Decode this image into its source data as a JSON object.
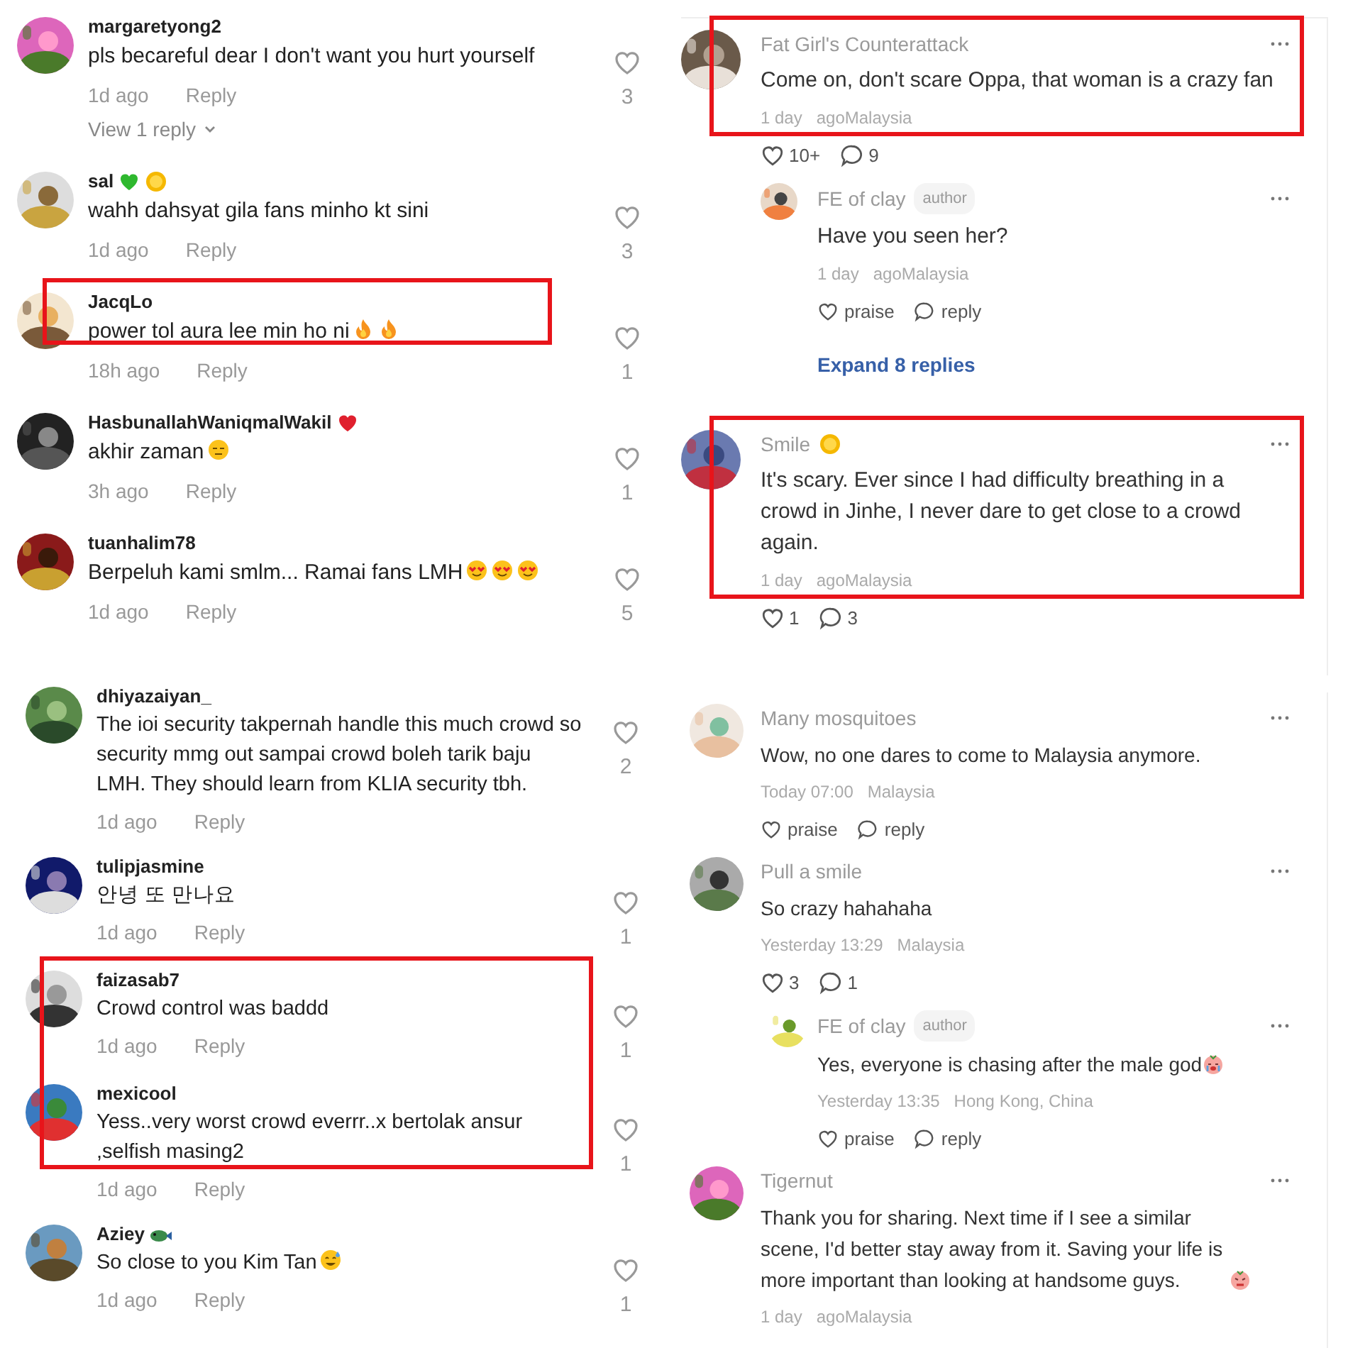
{
  "panels": [
    {
      "kind": "plain",
      "comments": [
        {
          "user": "margaretyong2",
          "text": "pls becareful dear I don't want you hurt yourself",
          "time": "1d ago",
          "reply": "Reply",
          "likes": "3",
          "view_replies": "View 1 reply",
          "highlighted": false
        },
        {
          "user": "sal",
          "text": "wahh dahsyat gila fans minho kt sini",
          "time": "1d ago",
          "reply": "Reply",
          "likes": "3",
          "highlighted": false
        },
        {
          "user": "JacqLo",
          "text": "power tol aura lee min ho ni",
          "time": "18h ago",
          "reply": "Reply",
          "likes": "1",
          "highlighted": true
        },
        {
          "user": "HasbunallahWaniqmalWakil",
          "text": "akhir zaman",
          "time": "3h ago",
          "reply": "Reply",
          "likes": "1",
          "highlighted": false
        },
        {
          "user": "tuanhalim78",
          "text": "Berpeluh kami smlm... Ramai fans LMH",
          "time": "1d ago",
          "reply": "Reply",
          "likes": "5",
          "highlighted": false
        }
      ]
    },
    {
      "kind": "threaded",
      "comments": [
        {
          "user": "Fat Girl's Counterattack",
          "text": "Come on, don't scare Oppa, that woman is a crazy fan",
          "time": "1 day",
          "location": "agoMalaysia",
          "actions": {
            "kind": "counts",
            "likes": "10+",
            "replies": "9"
          },
          "highlighted": true,
          "children": [
            {
              "user": "FE of clay",
              "tag": "author",
              "text": "Have you seen her?",
              "time": "1 day",
              "location": "agoMalaysia",
              "actions": {
                "kind": "labels",
                "like": "praise",
                "reply": "reply"
              },
              "highlighted": false
            }
          ],
          "expand": "Expand 8 replies"
        },
        {
          "user": "Smile",
          "text": "It's scary. Ever since I had difficulty breathing in a crowd in Jinhe, I never dare to get close to a crowd again.",
          "time": "1 day",
          "location": "agoMalaysia",
          "actions": {
            "kind": "counts",
            "likes": "1",
            "replies": "3"
          },
          "highlighted": true
        }
      ]
    },
    {
      "kind": "plain",
      "comments": [
        {
          "user": "dhiyazaiyan_",
          "text": "The ioi security takpernah handle this much crowd so security mmg out sampai crowd boleh tarik baju LMH. They should learn from KLIA security tbh.",
          "time": "1d ago",
          "reply": "Reply",
          "likes": "2",
          "highlighted": false
        },
        {
          "user": "tulipjasmine",
          "text": "안녕 또 만나요",
          "time": "1d ago",
          "reply": "Reply",
          "likes": "1",
          "highlighted": false
        },
        {
          "user": "faizasab7",
          "text": "Crowd control was baddd",
          "time": "1d ago",
          "reply": "Reply",
          "likes": "1",
          "highlighted": true
        },
        {
          "user": "mexicool",
          "text": "Yess..very worst crowd everrr..x bertolak ansur ,selfish masing2",
          "time": "1d ago",
          "reply": "Reply",
          "likes": "1",
          "highlighted": true
        },
        {
          "user": "Aziey",
          "text": "So close to you Kim Tan",
          "time": "1d ago",
          "reply": "Reply",
          "likes": "1",
          "highlighted": false
        }
      ]
    },
    {
      "kind": "threaded",
      "comments": [
        {
          "user": "Many mosquitoes",
          "text": "Wow, no one dares to come to Malaysia anymore.",
          "time": "Today 07:00",
          "location": "Malaysia",
          "actions": {
            "kind": "labels",
            "like": "praise",
            "reply": "reply"
          },
          "highlighted": false
        },
        {
          "user": "Pull a smile",
          "text": "So crazy hahahaha",
          "time": "Yesterday 13:29",
          "location": "Malaysia",
          "actions": {
            "kind": "counts",
            "likes": "3",
            "replies": "1"
          },
          "highlighted": false,
          "children": [
            {
              "user": "FE of clay",
              "tag": "author",
              "text": "Yes, everyone is chasing after the male god",
              "time": "Yesterday 13:35",
              "location": "Hong Kong, China",
              "actions": {
                "kind": "labels",
                "like": "praise",
                "reply": "reply"
              },
              "highlighted": false
            }
          ]
        },
        {
          "user": "Tigernut",
          "text": "Thank you for sharing. Next time if I see a similar scene, I'd better stay away from it. Saving your life is more important than looking at handsome guys.",
          "time": "1 day",
          "location": "agoMalaysia",
          "highlighted": false
        }
      ]
    }
  ]
}
